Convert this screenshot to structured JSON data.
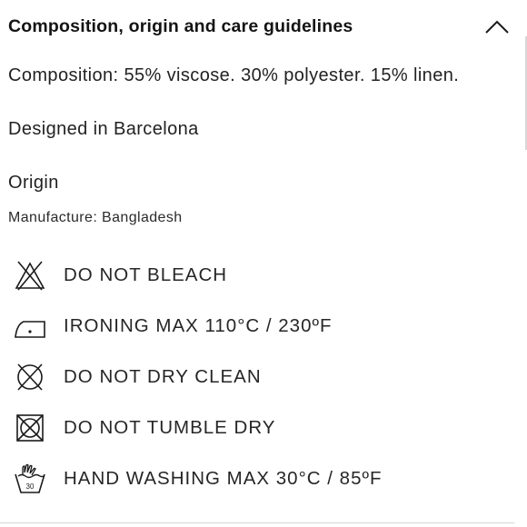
{
  "section": {
    "title": "Composition, origin and care guidelines",
    "expanded": true,
    "toggle_icon": "chevron-up-icon"
  },
  "composition": "Composition: 55% viscose. 30% polyester. 15% linen.",
  "designed": "Designed in Barcelona",
  "origin": {
    "heading": "Origin",
    "manufacture": "Manufacture: Bangladesh"
  },
  "care": [
    {
      "icon": "do-not-bleach-icon",
      "label": "DO NOT BLEACH"
    },
    {
      "icon": "iron-low-heat-icon",
      "label": "IRONING MAX 110°C / 230ºF"
    },
    {
      "icon": "do-not-dry-clean-icon",
      "label": "DO NOT DRY CLEAN"
    },
    {
      "icon": "do-not-tumble-dry-icon",
      "label": "DO NOT TUMBLE DRY"
    },
    {
      "icon": "hand-wash-icon",
      "label": "HAND WASHING MAX 30°C / 85ºF"
    }
  ],
  "colors": {
    "text": "#222222",
    "divider": "#d4d4d4"
  }
}
